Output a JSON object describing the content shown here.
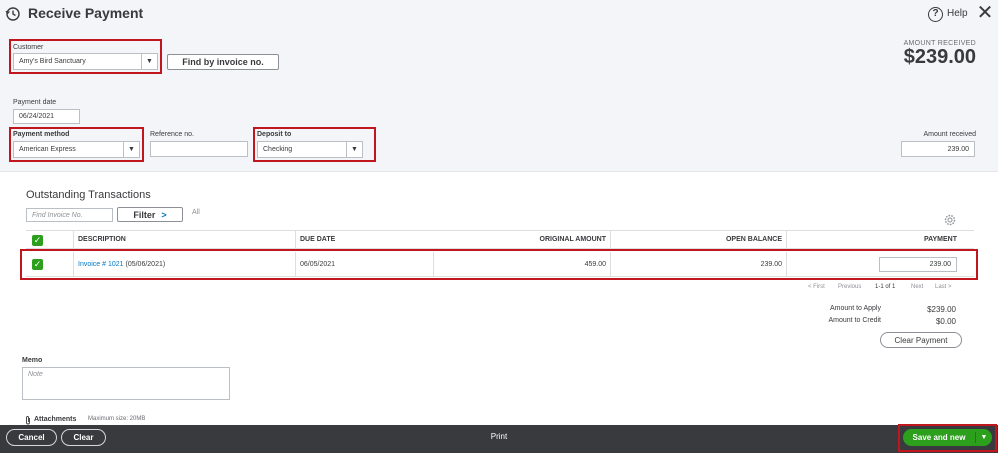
{
  "header": {
    "title": "Receive Payment",
    "help_label": "Help",
    "title_icon": "history-icon",
    "help_icon": "question-circle-icon",
    "close_icon": "close-icon"
  },
  "customer": {
    "label": "Customer",
    "value": "Amy's Bird Sanctuary",
    "find_button": "Find by invoice no."
  },
  "amount_received_header": {
    "label": "AMOUNT RECEIVED",
    "value": "$239.00"
  },
  "payment_date": {
    "label": "Payment date",
    "value": "06/24/2021"
  },
  "payment_method": {
    "label": "Payment method",
    "value": "American Express"
  },
  "reference": {
    "label": "Reference no.",
    "value": ""
  },
  "deposit_to": {
    "label": "Deposit to",
    "value": "Checking"
  },
  "amount_received": {
    "label": "Amount received",
    "value": "239.00"
  },
  "outstanding": {
    "title": "Outstanding Transactions",
    "find_placeholder": "Find Invoice No.",
    "filter_label": "Filter",
    "all_label": "All",
    "settings_icon": "gear-icon",
    "columns": {
      "description": "DESCRIPTION",
      "due_date": "DUE DATE",
      "original_amount": "ORIGINAL AMOUNT",
      "open_balance": "OPEN BALANCE",
      "payment": "PAYMENT"
    },
    "rows": [
      {
        "invoice_link": "Invoice # 1021",
        "invoice_date": "(05/06/2021)",
        "due_date": "06/05/2021",
        "original_amount": "459.00",
        "open_balance": "239.00",
        "payment": "239.00",
        "checked": true
      }
    ],
    "pager": {
      "first": "< First",
      "previous": "Previous",
      "range": "1-1 of 1",
      "next": "Next",
      "last": "Last >"
    }
  },
  "totals": {
    "apply_label": "Amount to Apply",
    "apply_value": "$239.00",
    "credit_label": "Amount to Credit",
    "credit_value": "$0.00",
    "clear_payment": "Clear Payment"
  },
  "memo": {
    "label": "Memo",
    "placeholder": "Note"
  },
  "attachments": {
    "label": "Attachments",
    "max_size": "Maximum size: 20MB",
    "icon": "paperclip-icon"
  },
  "footer": {
    "cancel": "Cancel",
    "clear": "Clear",
    "print": "Print",
    "save": "Save and new"
  },
  "colors": {
    "accent_green": "#2ca01c",
    "highlight_red": "#c1161d",
    "link_blue": "#0077c5",
    "footer_bg": "#393a3d"
  }
}
